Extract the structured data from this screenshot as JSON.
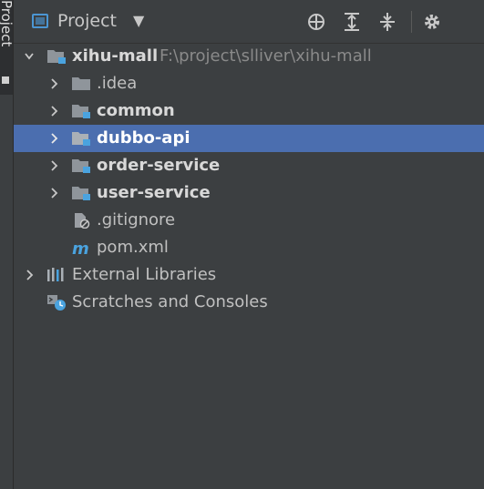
{
  "side_tab": {
    "label": "Project"
  },
  "header": {
    "title": "Project",
    "icons": [
      "project-view-icon",
      "chevron-down-icon",
      "locate-icon",
      "expand-all-icon",
      "collapse-all-icon",
      "gear-icon"
    ]
  },
  "tree": {
    "root": {
      "label": "xihu-mall",
      "path": "F:\\project\\slliver\\xihu-mall"
    },
    "items": [
      {
        "label": ".idea"
      },
      {
        "label": "common"
      },
      {
        "label": "dubbo-api"
      },
      {
        "label": "order-service"
      },
      {
        "label": "user-service"
      },
      {
        "label": ".gitignore"
      },
      {
        "label": "pom.xml"
      },
      {
        "label": "External Libraries"
      },
      {
        "label": "Scratches and Consoles"
      }
    ],
    "selected": "dubbo-api"
  },
  "colors": {
    "background": "#3c3f41",
    "selection": "#4b6eaf",
    "module_marker": "#4aa3df",
    "folder": "#8f959b"
  }
}
